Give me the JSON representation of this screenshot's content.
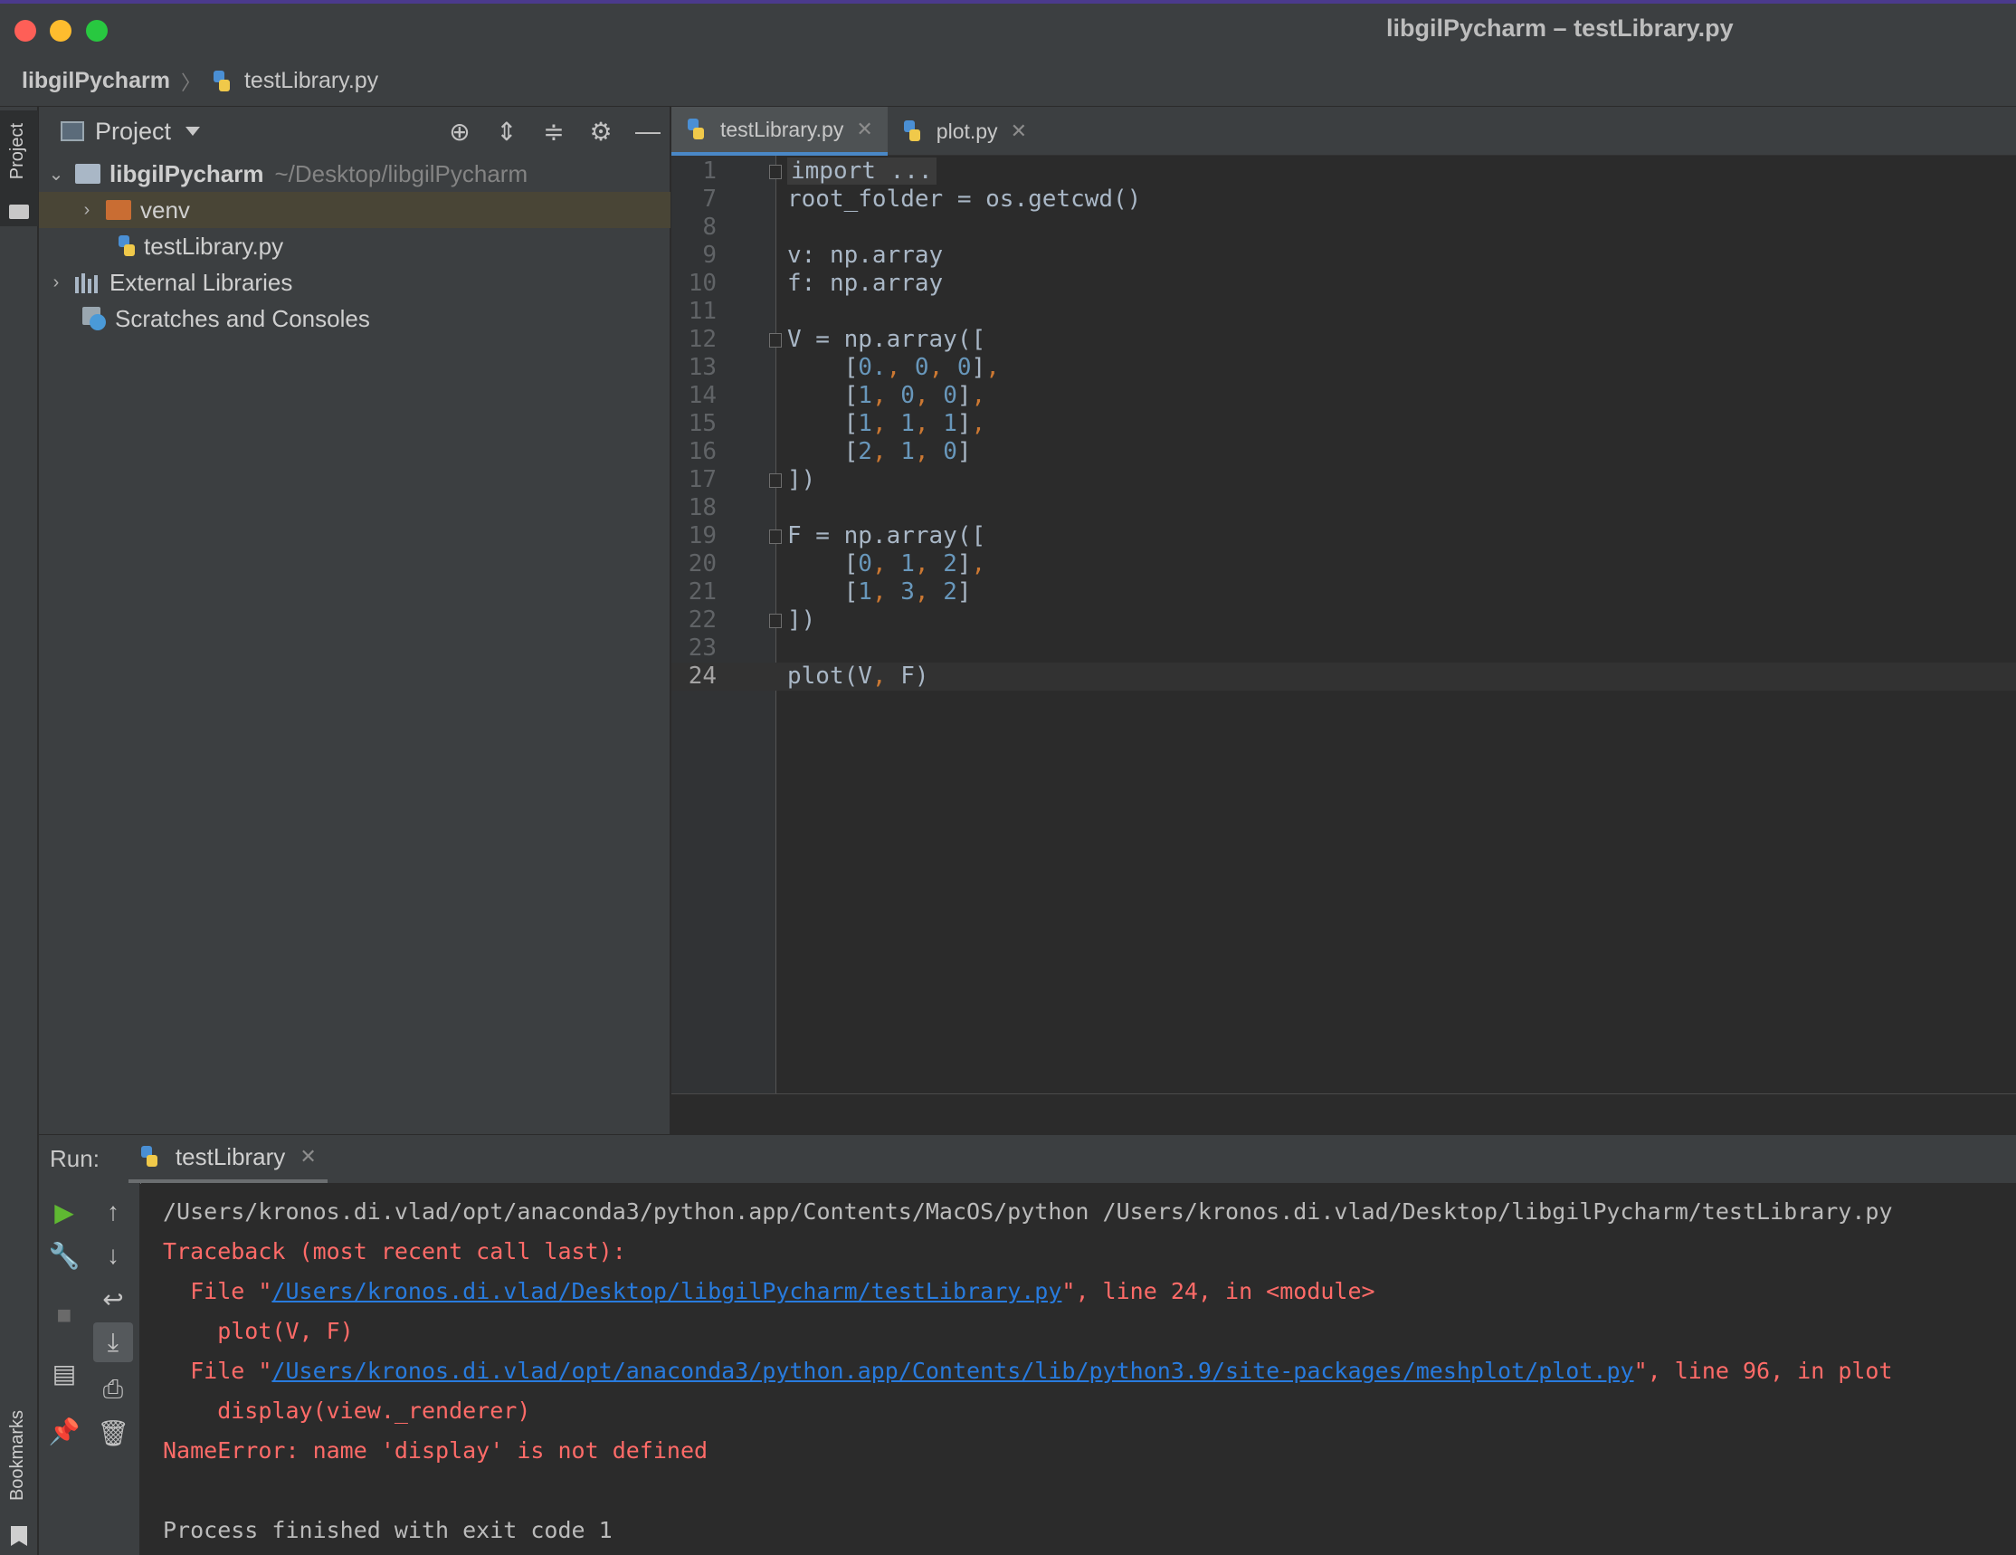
{
  "window": {
    "title": "libgilPycharm – testLibrary.py"
  },
  "breadcrumb": {
    "project": "libgilPycharm",
    "file": "testLibrary.py"
  },
  "left_strip": {
    "project_label": "Project",
    "bookmarks_label": "Bookmarks"
  },
  "project_panel": {
    "title": "Project",
    "tools": [
      "locate-icon",
      "expand-all-icon",
      "collapse-all-icon",
      "gear-icon",
      "minimize-icon"
    ],
    "tree": {
      "root_name": "libgilPycharm",
      "root_path": "~/Desktop/libgilPycharm",
      "venv": "venv",
      "file": "testLibrary.py",
      "external": "External Libraries",
      "scratches": "Scratches and Consoles"
    }
  },
  "editor": {
    "tabs": [
      {
        "label": "testLibrary.py",
        "active": true
      },
      {
        "label": "plot.py",
        "active": false
      }
    ],
    "lines": [
      {
        "n": "1",
        "text": "import ..."
      },
      {
        "n": "7",
        "text": "root_folder = os.getcwd()"
      },
      {
        "n": "8",
        "text": ""
      },
      {
        "n": "9",
        "text": "v: np.array"
      },
      {
        "n": "10",
        "text": "f: np.array"
      },
      {
        "n": "11",
        "text": ""
      },
      {
        "n": "12",
        "text": "V = np.array(["
      },
      {
        "n": "13",
        "text": "    [0., 0, 0],"
      },
      {
        "n": "14",
        "text": "    [1, 0, 0],"
      },
      {
        "n": "15",
        "text": "    [1, 1, 1],"
      },
      {
        "n": "16",
        "text": "    [2, 1, 0]"
      },
      {
        "n": "17",
        "text": "])"
      },
      {
        "n": "18",
        "text": ""
      },
      {
        "n": "19",
        "text": "F = np.array(["
      },
      {
        "n": "20",
        "text": "    [0, 1, 2],"
      },
      {
        "n": "21",
        "text": "    [1, 3, 2]"
      },
      {
        "n": "22",
        "text": "])"
      },
      {
        "n": "23",
        "text": ""
      },
      {
        "n": "24",
        "text": "plot(V, F)"
      }
    ]
  },
  "run": {
    "label": "Run:",
    "tab": "testLibrary",
    "console": {
      "cmd": "/Users/kronos.di.vlad/opt/anaconda3/python.app/Contents/MacOS/python /Users/kronos.di.vlad/Desktop/libgilPycharm/testLibrary.py",
      "traceback": "Traceback (most recent call last):",
      "file1_prefix": "  File \"",
      "file1_link": "/Users/kronos.di.vlad/Desktop/libgilPycharm/testLibrary.py",
      "file1_suffix": "\", line 24, in <module>",
      "code1": "    plot(V, F)",
      "file2_prefix": "  File \"",
      "file2_link": "/Users/kronos.di.vlad/opt/anaconda3/python.app/Contents/lib/python3.9/site-packages/meshplot/plot.py",
      "file2_suffix": "\", line 96, in plot",
      "code2": "    display(view._renderer)",
      "error": "NameError: name 'display' is not defined",
      "finished": "Process finished with exit code 1"
    }
  },
  "colors": {
    "background": "#2b2b2b",
    "panel": "#3c3f41",
    "code_text": "#a9b7c6",
    "number": "#6897bb",
    "punctuation": "#cc7832",
    "error": "#ff6b68",
    "link": "#287bde",
    "run_green": "#5fb832"
  }
}
